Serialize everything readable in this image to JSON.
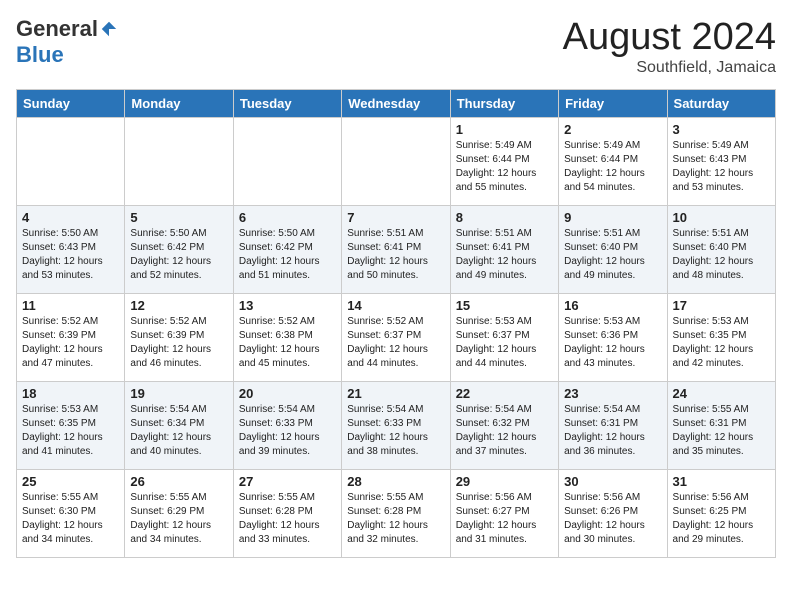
{
  "header": {
    "logo_general": "General",
    "logo_blue": "Blue",
    "month_title": "August 2024",
    "location": "Southfield, Jamaica"
  },
  "weekdays": [
    "Sunday",
    "Monday",
    "Tuesday",
    "Wednesday",
    "Thursday",
    "Friday",
    "Saturday"
  ],
  "weeks": [
    [
      {
        "day": "",
        "info": ""
      },
      {
        "day": "",
        "info": ""
      },
      {
        "day": "",
        "info": ""
      },
      {
        "day": "",
        "info": ""
      },
      {
        "day": "1",
        "info": "Sunrise: 5:49 AM\nSunset: 6:44 PM\nDaylight: 12 hours\nand 55 minutes."
      },
      {
        "day": "2",
        "info": "Sunrise: 5:49 AM\nSunset: 6:44 PM\nDaylight: 12 hours\nand 54 minutes."
      },
      {
        "day": "3",
        "info": "Sunrise: 5:49 AM\nSunset: 6:43 PM\nDaylight: 12 hours\nand 53 minutes."
      }
    ],
    [
      {
        "day": "4",
        "info": "Sunrise: 5:50 AM\nSunset: 6:43 PM\nDaylight: 12 hours\nand 53 minutes."
      },
      {
        "day": "5",
        "info": "Sunrise: 5:50 AM\nSunset: 6:42 PM\nDaylight: 12 hours\nand 52 minutes."
      },
      {
        "day": "6",
        "info": "Sunrise: 5:50 AM\nSunset: 6:42 PM\nDaylight: 12 hours\nand 51 minutes."
      },
      {
        "day": "7",
        "info": "Sunrise: 5:51 AM\nSunset: 6:41 PM\nDaylight: 12 hours\nand 50 minutes."
      },
      {
        "day": "8",
        "info": "Sunrise: 5:51 AM\nSunset: 6:41 PM\nDaylight: 12 hours\nand 49 minutes."
      },
      {
        "day": "9",
        "info": "Sunrise: 5:51 AM\nSunset: 6:40 PM\nDaylight: 12 hours\nand 49 minutes."
      },
      {
        "day": "10",
        "info": "Sunrise: 5:51 AM\nSunset: 6:40 PM\nDaylight: 12 hours\nand 48 minutes."
      }
    ],
    [
      {
        "day": "11",
        "info": "Sunrise: 5:52 AM\nSunset: 6:39 PM\nDaylight: 12 hours\nand 47 minutes."
      },
      {
        "day": "12",
        "info": "Sunrise: 5:52 AM\nSunset: 6:39 PM\nDaylight: 12 hours\nand 46 minutes."
      },
      {
        "day": "13",
        "info": "Sunrise: 5:52 AM\nSunset: 6:38 PM\nDaylight: 12 hours\nand 45 minutes."
      },
      {
        "day": "14",
        "info": "Sunrise: 5:52 AM\nSunset: 6:37 PM\nDaylight: 12 hours\nand 44 minutes."
      },
      {
        "day": "15",
        "info": "Sunrise: 5:53 AM\nSunset: 6:37 PM\nDaylight: 12 hours\nand 44 minutes."
      },
      {
        "day": "16",
        "info": "Sunrise: 5:53 AM\nSunset: 6:36 PM\nDaylight: 12 hours\nand 43 minutes."
      },
      {
        "day": "17",
        "info": "Sunrise: 5:53 AM\nSunset: 6:35 PM\nDaylight: 12 hours\nand 42 minutes."
      }
    ],
    [
      {
        "day": "18",
        "info": "Sunrise: 5:53 AM\nSunset: 6:35 PM\nDaylight: 12 hours\nand 41 minutes."
      },
      {
        "day": "19",
        "info": "Sunrise: 5:54 AM\nSunset: 6:34 PM\nDaylight: 12 hours\nand 40 minutes."
      },
      {
        "day": "20",
        "info": "Sunrise: 5:54 AM\nSunset: 6:33 PM\nDaylight: 12 hours\nand 39 minutes."
      },
      {
        "day": "21",
        "info": "Sunrise: 5:54 AM\nSunset: 6:33 PM\nDaylight: 12 hours\nand 38 minutes."
      },
      {
        "day": "22",
        "info": "Sunrise: 5:54 AM\nSunset: 6:32 PM\nDaylight: 12 hours\nand 37 minutes."
      },
      {
        "day": "23",
        "info": "Sunrise: 5:54 AM\nSunset: 6:31 PM\nDaylight: 12 hours\nand 36 minutes."
      },
      {
        "day": "24",
        "info": "Sunrise: 5:55 AM\nSunset: 6:31 PM\nDaylight: 12 hours\nand 35 minutes."
      }
    ],
    [
      {
        "day": "25",
        "info": "Sunrise: 5:55 AM\nSunset: 6:30 PM\nDaylight: 12 hours\nand 34 minutes."
      },
      {
        "day": "26",
        "info": "Sunrise: 5:55 AM\nSunset: 6:29 PM\nDaylight: 12 hours\nand 34 minutes."
      },
      {
        "day": "27",
        "info": "Sunrise: 5:55 AM\nSunset: 6:28 PM\nDaylight: 12 hours\nand 33 minutes."
      },
      {
        "day": "28",
        "info": "Sunrise: 5:55 AM\nSunset: 6:28 PM\nDaylight: 12 hours\nand 32 minutes."
      },
      {
        "day": "29",
        "info": "Sunrise: 5:56 AM\nSunset: 6:27 PM\nDaylight: 12 hours\nand 31 minutes."
      },
      {
        "day": "30",
        "info": "Sunrise: 5:56 AM\nSunset: 6:26 PM\nDaylight: 12 hours\nand 30 minutes."
      },
      {
        "day": "31",
        "info": "Sunrise: 5:56 AM\nSunset: 6:25 PM\nDaylight: 12 hours\nand 29 minutes."
      }
    ]
  ]
}
